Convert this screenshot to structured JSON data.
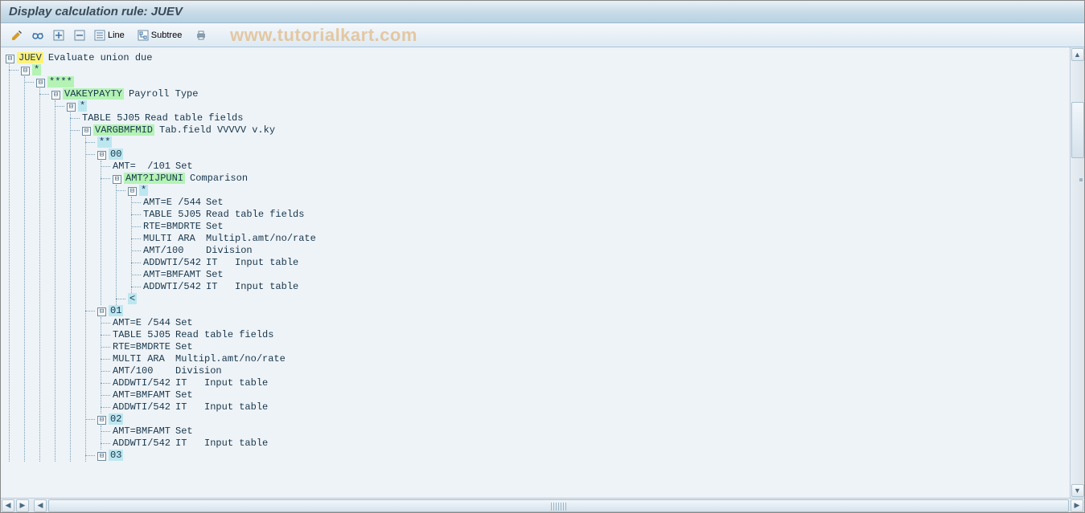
{
  "title": "Display calculation rule: JUEV",
  "watermark": "www.tutorialkart.com",
  "toolbar": {
    "line_label": "Line",
    "subtree_label": "Subtree"
  },
  "tree": {
    "label": "JUEV",
    "desc": "Evaluate union due",
    "hl": "yellow",
    "toggle": true,
    "children": [
      {
        "label": "*",
        "hl": "green",
        "toggle": true,
        "children": [
          {
            "label": "****",
            "hl": "green",
            "toggle": true,
            "children": [
              {
                "label": "VAKEYPAYTY",
                "desc": "Payroll Type",
                "hl": "green",
                "toggle": true,
                "children": [
                  {
                    "label": "*",
                    "hl": "cyan",
                    "toggle": true,
                    "children": [
                      {
                        "label": "TABLE 5J05",
                        "desc": "Read table fields"
                      },
                      {
                        "label": "VARGBMFMID",
                        "desc": "Tab.field VVVVV v.ky",
                        "hl": "green",
                        "toggle": true,
                        "children": [
                          {
                            "label": "**",
                            "hl": "cyan"
                          },
                          {
                            "label": "00",
                            "hl": "cyan",
                            "toggle": true,
                            "children": [
                              {
                                "label": "AMT=  /101",
                                "desc": "Set"
                              },
                              {
                                "label": "AMT?IJPUNI",
                                "desc": "Comparison",
                                "hl": "green",
                                "toggle": true,
                                "children": [
                                  {
                                    "label": "*",
                                    "hl": "cyan",
                                    "toggle": true,
                                    "children": [
                                      {
                                        "label": "AMT=E /544",
                                        "desc": "Set"
                                      },
                                      {
                                        "label": "TABLE 5J05",
                                        "desc": "Read table fields"
                                      },
                                      {
                                        "label": "RTE=BMDRTE",
                                        "desc": "Set"
                                      },
                                      {
                                        "label": "MULTI ARA ",
                                        "desc": "Multipl.amt/no/rate"
                                      },
                                      {
                                        "label": "AMT/100   ",
                                        "desc": "Division"
                                      },
                                      {
                                        "label": "ADDWTI/542",
                                        "desc": "IT   Input table"
                                      },
                                      {
                                        "label": "AMT=BMFAMT",
                                        "desc": "Set"
                                      },
                                      {
                                        "label": "ADDWTI/542",
                                        "desc": "IT   Input table"
                                      }
                                    ]
                                  },
                                  {
                                    "label": "<",
                                    "hl": "cyan"
                                  }
                                ]
                              }
                            ]
                          },
                          {
                            "label": "01",
                            "hl": "cyan",
                            "toggle": true,
                            "children": [
                              {
                                "label": "AMT=E /544",
                                "desc": "Set"
                              },
                              {
                                "label": "TABLE 5J05",
                                "desc": "Read table fields"
                              },
                              {
                                "label": "RTE=BMDRTE",
                                "desc": "Set"
                              },
                              {
                                "label": "MULTI ARA ",
                                "desc": "Multipl.amt/no/rate"
                              },
                              {
                                "label": "AMT/100   ",
                                "desc": "Division"
                              },
                              {
                                "label": "ADDWTI/542",
                                "desc": "IT   Input table"
                              },
                              {
                                "label": "AMT=BMFAMT",
                                "desc": "Set"
                              },
                              {
                                "label": "ADDWTI/542",
                                "desc": "IT   Input table"
                              }
                            ]
                          },
                          {
                            "label": "02",
                            "hl": "cyan",
                            "toggle": true,
                            "children": [
                              {
                                "label": "AMT=BMFAMT",
                                "desc": "Set"
                              },
                              {
                                "label": "ADDWTI/542",
                                "desc": "IT   Input table"
                              }
                            ]
                          },
                          {
                            "label": "03",
                            "hl": "cyan",
                            "toggle": true
                          }
                        ]
                      }
                    ]
                  }
                ]
              }
            ]
          }
        ]
      }
    ]
  }
}
